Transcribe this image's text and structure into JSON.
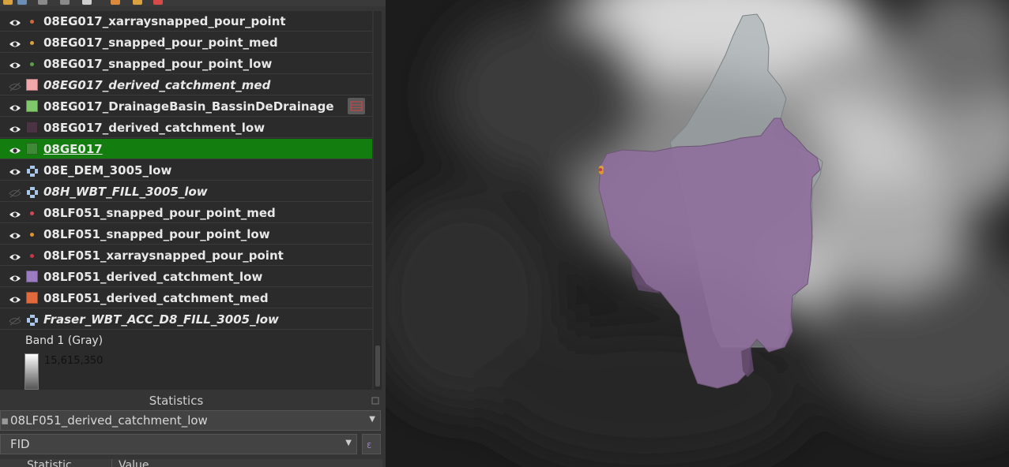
{
  "layers": [
    {
      "name": "08EG017_xarraysnapped_pour_point",
      "visible": true,
      "symbol": "dot",
      "color": "#c96a45"
    },
    {
      "name": "08EG017_snapped_pour_point_med",
      "visible": true,
      "symbol": "dot",
      "color": "#d9a23c"
    },
    {
      "name": "08EG017_snapped_pour_point_low",
      "visible": true,
      "symbol": "dot",
      "color": "#5e9e4a"
    },
    {
      "name": "08EG017_derived_catchment_med",
      "visible": false,
      "symbol": "fill",
      "color": "#f2a7ab"
    },
    {
      "name": "08EG017_DrainageBasin_BassinDeDrainage",
      "visible": true,
      "symbol": "fill",
      "color": "#7fc96a",
      "has_edit": true
    },
    {
      "name": "08EG017_derived_catchment_low",
      "visible": true,
      "symbol": "fill",
      "color": "#4a3443"
    },
    {
      "name": "08GE017",
      "visible": true,
      "symbol": "fill",
      "color": "#3f8a36",
      "selected": true
    },
    {
      "name": "08E_DEM_3005_low",
      "visible": true,
      "symbol": "raster",
      "color": "#a9c7ea"
    },
    {
      "name": "08H_WBT_FILL_3005_low",
      "visible": false,
      "symbol": "raster",
      "color": "#a9c7ea"
    },
    {
      "name": "08LF051_snapped_pour_point_med",
      "visible": true,
      "symbol": "dot",
      "color": "#d04a5a"
    },
    {
      "name": "08LF051_snapped_pour_point_low",
      "visible": true,
      "symbol": "dot",
      "color": "#e0962d"
    },
    {
      "name": "08LF051_xarraysnapped_pour_point",
      "visible": true,
      "symbol": "dot",
      "color": "#c23a4a"
    },
    {
      "name": "08LF051_derived_catchment_low",
      "visible": true,
      "symbol": "fill",
      "color": "#9b7bc2"
    },
    {
      "name": "08LF051_derived_catchment_med",
      "visible": true,
      "symbol": "fill",
      "color": "#e06a3c"
    },
    {
      "name": "Fraser_WBT_ACC_D8_FILL_3005_low",
      "visible": false,
      "symbol": "raster",
      "color": "#a9c7ea"
    }
  ],
  "legend": {
    "band_label": "Band 1 (Gray)",
    "max_value": "15,615,350"
  },
  "statistics": {
    "title": "Statistics",
    "layer_select": "08LF051_derived_catchment_low",
    "field_select": "FID",
    "columns": [
      "Statistic",
      "Value"
    ]
  },
  "colors": {
    "selection": "#137d0f",
    "panel": "#2b2b2b",
    "catchment_purple": "#8e6f99",
    "catchment_grey": "#9aa5a8"
  }
}
